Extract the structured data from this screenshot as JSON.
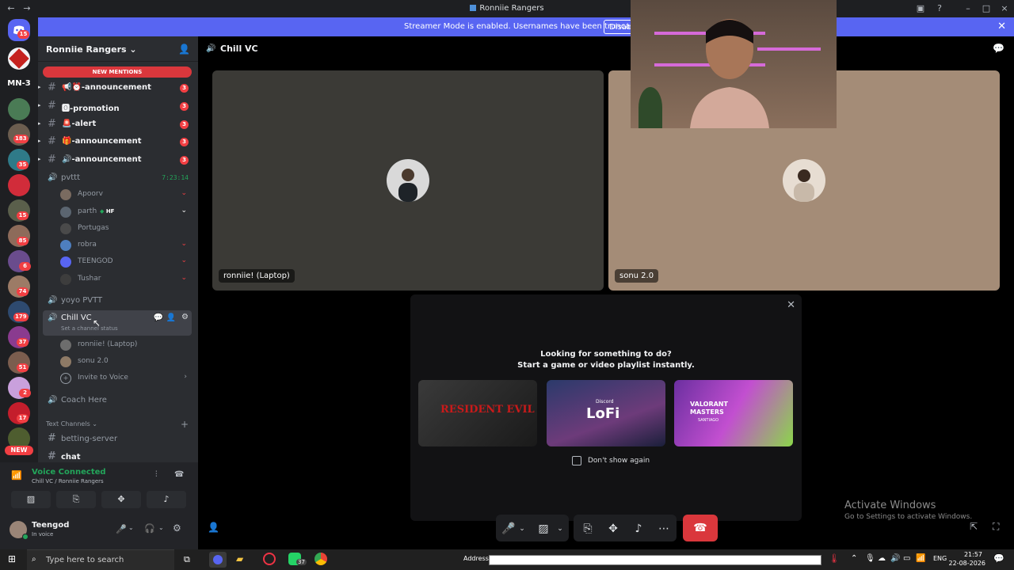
{
  "window": {
    "title": "Ronniie Rangers"
  },
  "banner": {
    "text": "Streamer Mode is enabled. Usernames have been truncated.",
    "button": "Disable"
  },
  "rail": {
    "labels": {
      "mn3": "MN-3",
      "new": "NEW"
    },
    "badges": [
      "15",
      "183",
      "35",
      "15",
      "85",
      "6",
      "74",
      "179",
      "37",
      "51",
      "2",
      "17"
    ]
  },
  "server": {
    "name": "Ronniie Rangers"
  },
  "sidebar": {
    "new_mentions": "NEW MENTIONS",
    "channels": [
      {
        "name": "📢⏰-announcement",
        "count": "3"
      },
      {
        "name": "🅾-promotion",
        "count": "3"
      },
      {
        "name": "🚨-alert",
        "count": "3"
      },
      {
        "name": "🎁-announcement",
        "count": "3"
      },
      {
        "name": "🔊-announcement",
        "count": "3"
      }
    ],
    "voice1": {
      "name": "pvttt",
      "timer": "7:23:14"
    },
    "voice1_users": [
      "Apoorv",
      "parth",
      "Portugas",
      "robra",
      "TEENGOD",
      "Tushar"
    ],
    "parth_tag": "HF",
    "voice2": {
      "name": "yoyo PVTT"
    },
    "voice3": {
      "name": "Chill VC",
      "status": "Set a channel status"
    },
    "voice3_users": [
      "ronniie! (Laptop)",
      "sonu 2.0"
    ],
    "invite": "Invite to Voice",
    "voice4": {
      "name": "Coach Here"
    },
    "category": "Text Channels",
    "text_channels": [
      "betting-server",
      "chat"
    ]
  },
  "voice_panel": {
    "status": "Voice Connected",
    "channel": "Chill VC / Ronniie Rangers"
  },
  "user": {
    "name": "Teengod",
    "status": "In voice"
  },
  "main": {
    "channel": "Chill VC",
    "tiles": [
      {
        "label": "ronniie! (Laptop)",
        "bg": "#3b3a36"
      },
      {
        "label": "sonu 2.0",
        "bg": "#a48c77"
      }
    ]
  },
  "popup": {
    "line1": "Looking for something to do?",
    "line2": "Start a game or video playlist instantly.",
    "cards": [
      "RESIDENT EVIL",
      "LoFi",
      "VALORANT MASTERS"
    ],
    "lofi_brand": "Discord",
    "valorant_sub": "SANTIAGO",
    "checkbox": "Don't show again"
  },
  "watermark": {
    "line1": "Activate Windows",
    "line2": "Go to Settings to activate Windows."
  },
  "taskbar": {
    "search_placeholder": "Type here to search",
    "address_label": "Address",
    "lang": "ENG",
    "time": "21:57",
    "date": "22-08-2026",
    "badge": "37"
  },
  "colors": {
    "accent": "#5865f2",
    "danger": "#da373c",
    "online": "#23a55a"
  }
}
